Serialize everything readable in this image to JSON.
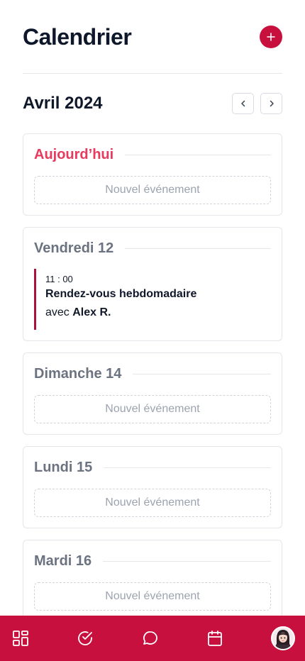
{
  "header": {
    "title": "Calendrier"
  },
  "calendar": {
    "month": "Avril 2024"
  },
  "days": [
    {
      "title": "Aujourd’hui",
      "new_event": "Nouvel événement"
    },
    {
      "title": "Vendredi 12",
      "event": {
        "time": "11 : 00",
        "title": "Rendez-vous hebdomadaire",
        "with_prefix": "avec",
        "with_name": "Alex R."
      }
    },
    {
      "title": "Dimanche 14",
      "new_event": "Nouvel événement"
    },
    {
      "title": "Lundi 15",
      "new_event": "Nouvel événement"
    },
    {
      "title": "Mardi 16",
      "new_event": "Nouvel événement"
    }
  ],
  "icons": {
    "add": "plus-icon",
    "prev": "chevron-left-icon",
    "next": "chevron-right-icon",
    "nav": [
      "dashboard-icon",
      "check-circle-icon",
      "chat-bubble-icon",
      "calendar-icon",
      "avatar"
    ]
  },
  "colors": {
    "accent": "#c8103e",
    "today": "#e83a5d",
    "event_bar": "#b0103d"
  }
}
